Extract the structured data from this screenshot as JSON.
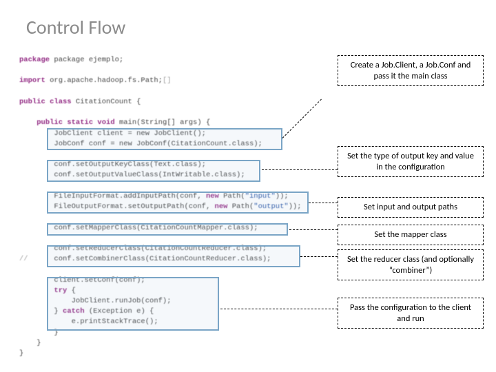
{
  "title": "Control Flow",
  "code": {
    "l1": "package ejemplo;",
    "l2": "import org.apache.hadoop.fs.Path;",
    "l3": "public class CitationCount {",
    "l4": "    public static void main(String[] args) {",
    "l5": "        JobClient client = new JobClient();",
    "l6": "        JobConf conf = new JobConf(CitationCount.class);",
    "l7": "        conf.setOutputKeyClass(Text.class);",
    "l8": "        conf.setOutputValueClass(IntWritable.class);",
    "l9": "        FileInputFormat.addInputPath(conf, new Path(\"input\"));",
    "l10": "        FileOutputFormat.setOutputPath(conf, new Path(\"output\"));",
    "l11": "        conf.setMapperClass(CitationCountMapper.class);",
    "l12": "        conf.setReducerClass(CitationCountReducer.class);",
    "l13": "//      conf.setCombinerClass(CitationCountReducer.class);",
    "l14": "        client.setConf(conf);",
    "l15": "        try {",
    "l16": "            JobClient.runJob(conf);",
    "l17": "        } catch (Exception e) {",
    "l18": "            e.printStackTrace();",
    "l19": "        }",
    "l20": "    }",
    "l21": "}"
  },
  "annotations": {
    "a1": "Create a Job.Client, a Job.Conf and pass it the main class",
    "a2": "Set the type of output key and value in the configuration",
    "a3": "Set input and output paths",
    "a4": "Set the mapper class",
    "a5": "Set the reducer class (and optionally “combiner”)",
    "a6": "Pass the configuration to the client and run"
  }
}
